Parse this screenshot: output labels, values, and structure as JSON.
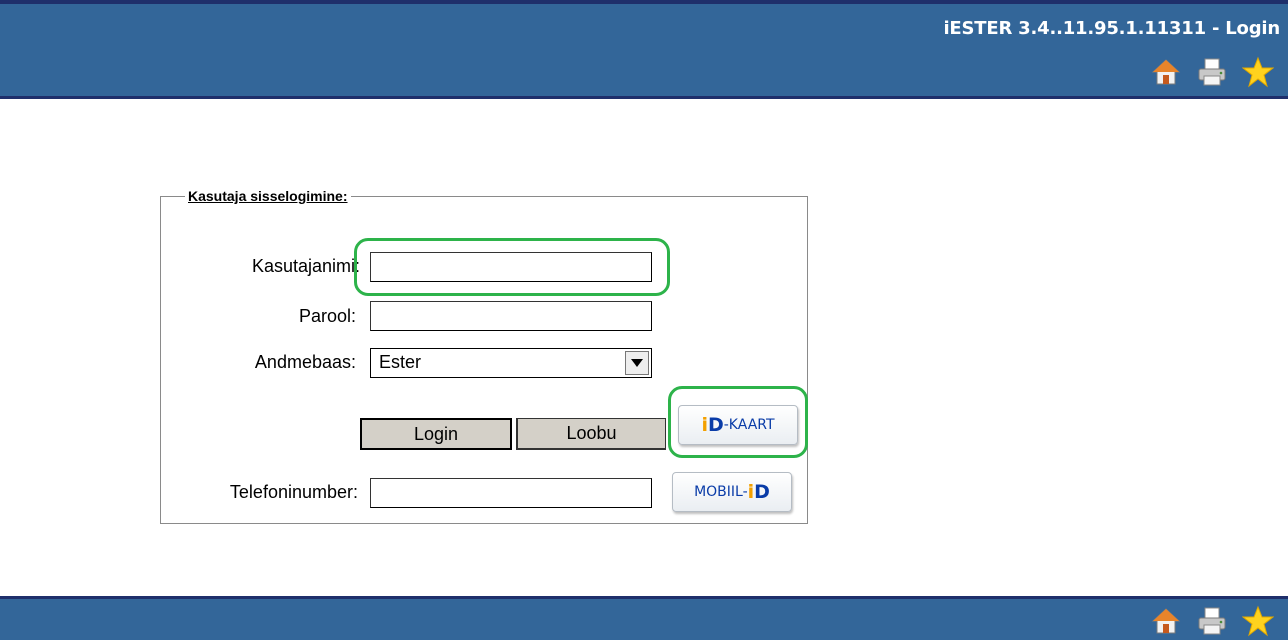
{
  "header": {
    "title": "iESTER 3.4..11.95.1.11311 - Login",
    "icons": [
      "home-icon",
      "print-icon",
      "favorite-star-icon"
    ]
  },
  "login": {
    "legend": "Kasutaja sisselogimine:",
    "username_label": "Kasutajanimi:",
    "username_value": "",
    "password_label": "Parool:",
    "password_value": "",
    "database_label": "Andmebaas:",
    "database_selected": "Ester",
    "login_button": "Login",
    "cancel_button": "Loobu",
    "id_card_button_prefix": "D",
    "id_card_button_suffix": "-KAART",
    "phone_label": "Telefoninumber:",
    "phone_value": "",
    "mobile_id_prefix": "MOBIIL-",
    "mobile_id_suffix": "D"
  },
  "footer": {
    "icons": [
      "home-icon",
      "print-icon",
      "favorite-star-icon"
    ]
  },
  "colors": {
    "header_bg": "#336699",
    "header_border": "#1f2f6b",
    "highlight": "#2db34a",
    "id_blue": "#0a3ca8",
    "id_orange": "#f3a000"
  }
}
